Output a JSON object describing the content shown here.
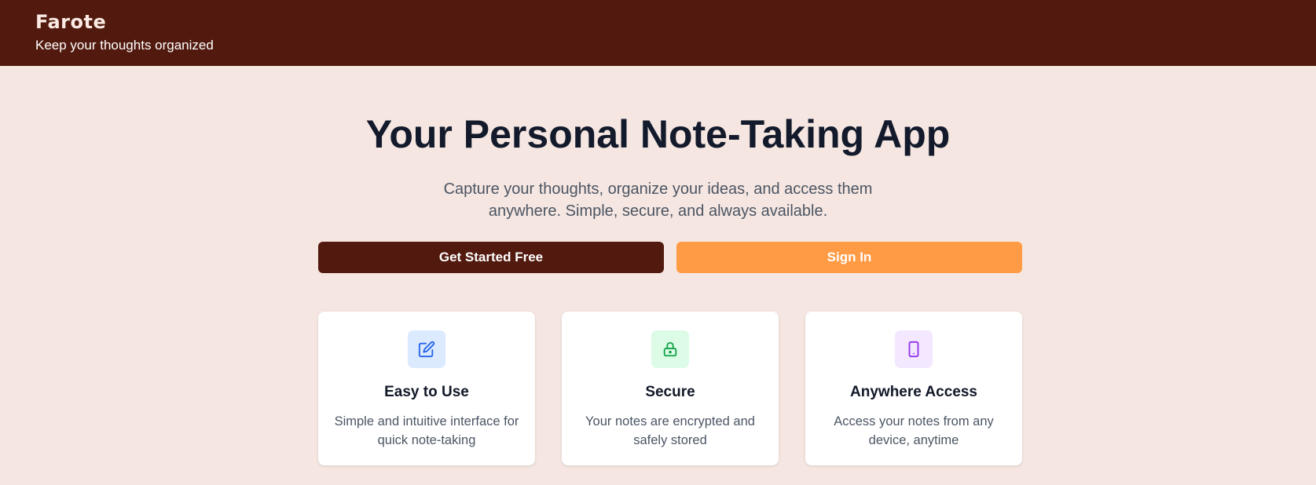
{
  "header": {
    "logo": "Farote",
    "tagline": "Keep your thoughts organized",
    "background": "#521a0e"
  },
  "hero": {
    "title": "Your Personal Note-Taking App",
    "subtitle": "Capture your thoughts, organize your ideas, and access them anywhere. Simple, secure, and always available."
  },
  "buttons": {
    "get_started": "Get Started Free",
    "sign_in": "Sign In",
    "primary_color": "#521a0e",
    "secondary_color": "#ff9b45"
  },
  "features": [
    {
      "title": "Easy to Use",
      "description": "Simple and intuitive interface for quick note-taking",
      "icon": "edit-icon",
      "icon_color": "#2563eb",
      "icon_bg": "#dbeafe"
    },
    {
      "title": "Secure",
      "description": "Your notes are encrypted and safely stored",
      "icon": "lock-icon",
      "icon_color": "#16a34a",
      "icon_bg": "#dcfce7"
    },
    {
      "title": "Anywhere Access",
      "description": "Access your notes from any device, anytime",
      "icon": "phone-icon",
      "icon_color": "#9333ea",
      "icon_bg": "#f3e8ff"
    }
  ]
}
